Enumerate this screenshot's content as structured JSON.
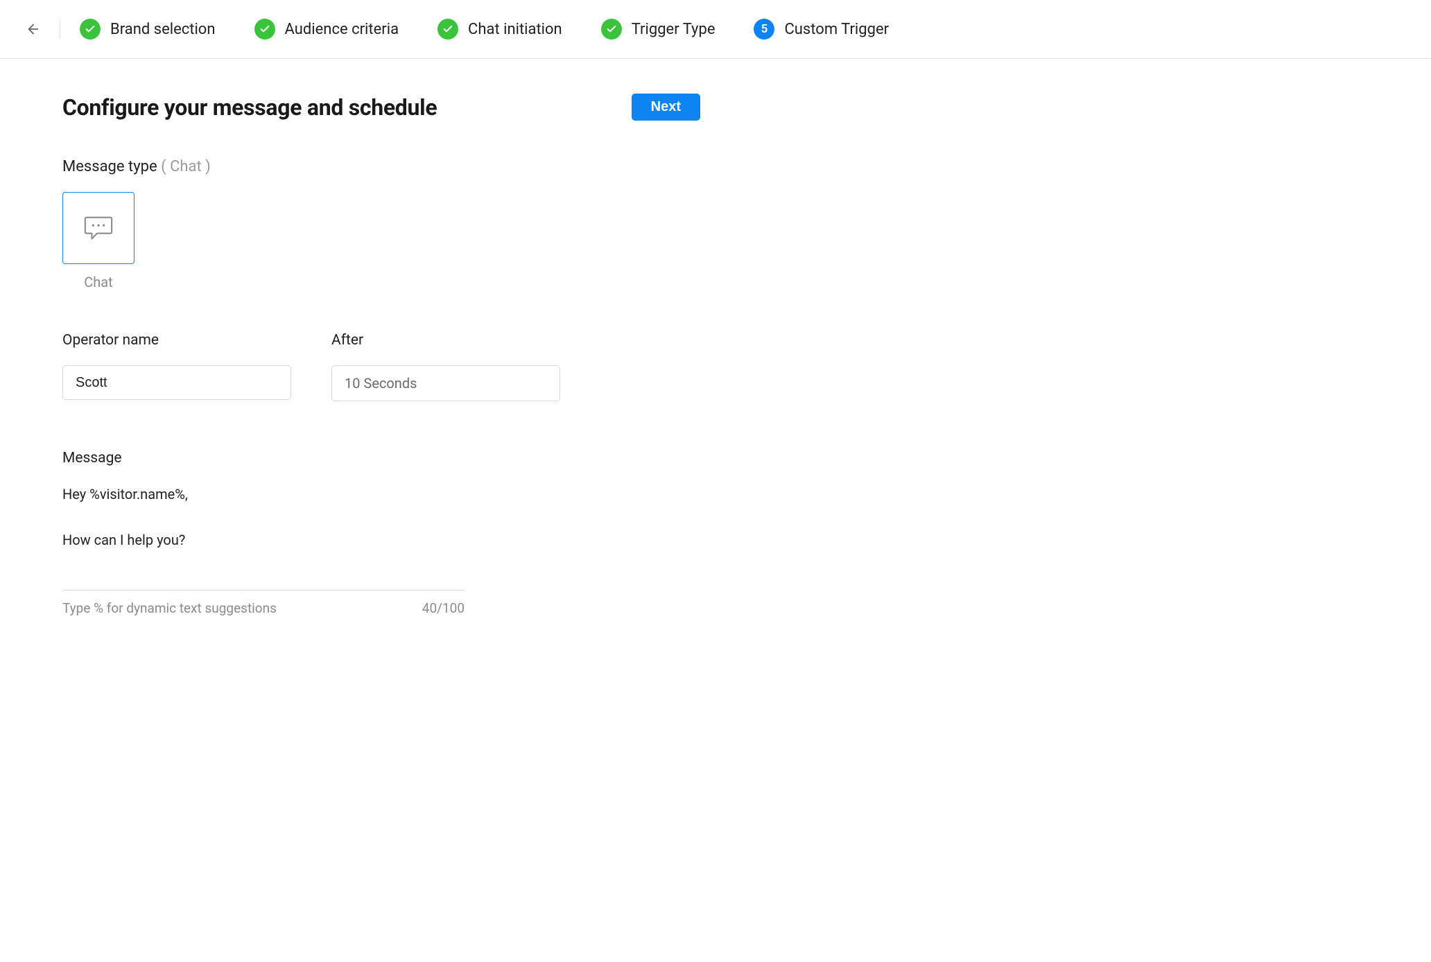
{
  "steps": [
    {
      "label": "Brand selection",
      "state": "done"
    },
    {
      "label": "Audience criteria",
      "state": "done"
    },
    {
      "label": "Chat initiation",
      "state": "done"
    },
    {
      "label": "Trigger Type",
      "state": "done"
    },
    {
      "label": "Custom Trigger",
      "state": "current",
      "number": "5"
    }
  ],
  "page": {
    "title": "Configure your message and schedule",
    "next_button": "Next"
  },
  "message_type": {
    "label": "Message type",
    "selected_label": "( Chat )",
    "option_caption": "Chat"
  },
  "operator": {
    "label": "Operator name",
    "value": "Scott"
  },
  "after": {
    "label": "After",
    "value": "10 Seconds"
  },
  "message": {
    "label": "Message",
    "value": "Hey %visitor.name%,\n\nHow can I help you?",
    "hint": "Type % for dynamic text suggestions",
    "counter": "40/100"
  }
}
